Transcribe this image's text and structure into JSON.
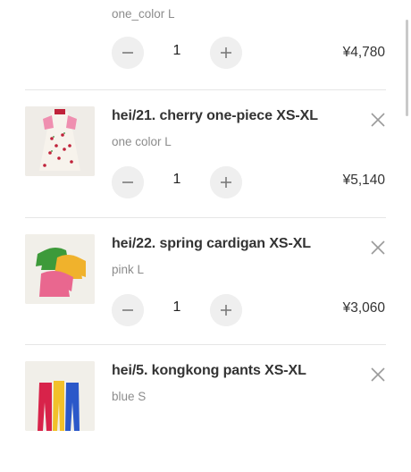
{
  "cart": {
    "items": [
      {
        "title": "",
        "variant": "one_color L",
        "quantity": "1",
        "price": "¥4,780",
        "image": "blue-polka-dot-dress"
      },
      {
        "title": "hei/21. cherry one-piece XS-XL",
        "variant": "one color L",
        "quantity": "1",
        "price": "¥5,140",
        "image": "cherry-print-dress"
      },
      {
        "title": "hei/22. spring cardigan XS-XL",
        "variant": "pink L",
        "quantity": "1",
        "price": "¥3,060",
        "image": "spring-cardigans"
      },
      {
        "title": "hei/5. kongkong pants XS-XL",
        "variant": "blue S",
        "quantity": "",
        "price": "",
        "image": "colored-pants"
      }
    ]
  },
  "icons": {
    "remove": "close-icon",
    "decrease": "minus-icon",
    "increase": "plus-icon"
  },
  "colors": {
    "button_bg": "#efefef",
    "text": "#333333",
    "muted_text": "#8c8c8c",
    "divider": "#e6e6e6"
  }
}
